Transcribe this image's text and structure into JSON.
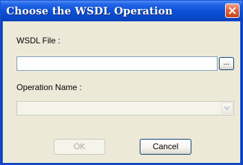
{
  "window": {
    "title": "Choose the WSDL Operation"
  },
  "form": {
    "wsdl_label": "WSDL File :",
    "wsdl_value": "",
    "browse_label": "...",
    "operation_label": "Operation Name :",
    "operation_value": ""
  },
  "buttons": {
    "ok_label": "OK",
    "cancel_label": "Cancel"
  },
  "colors": {
    "titlebar": "#0b50d8",
    "close": "#e0643f",
    "panel": "#ece9d8"
  },
  "icons": {
    "close": "close-icon",
    "dropdown": "chevron-down-icon"
  }
}
